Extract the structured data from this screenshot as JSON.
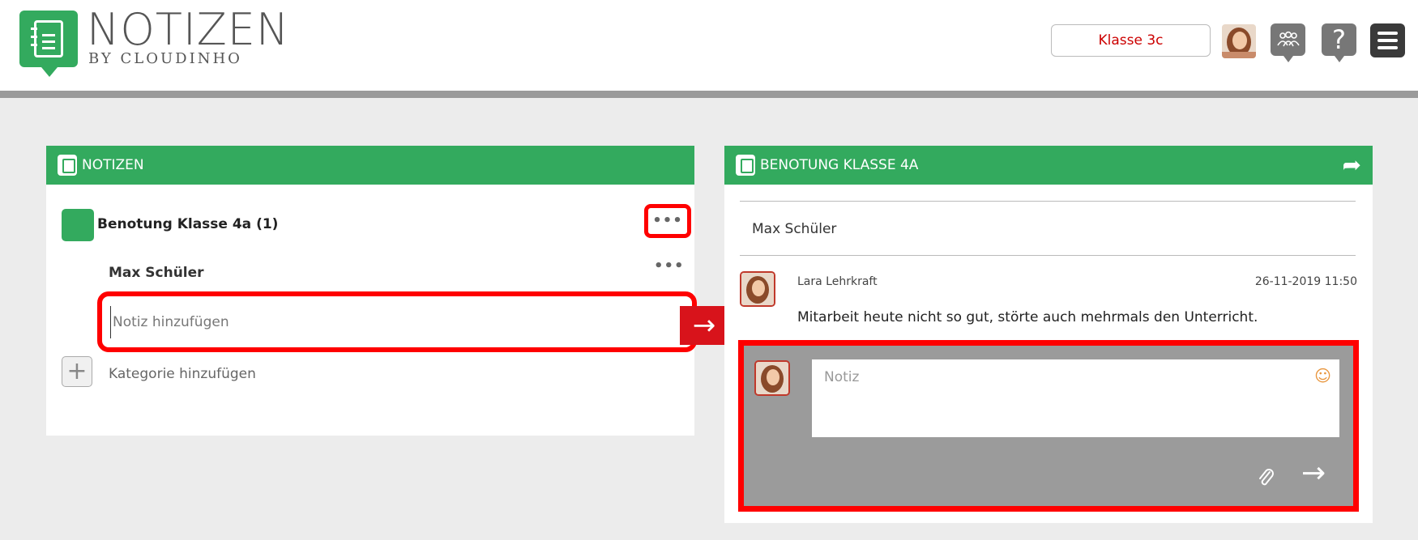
{
  "app": {
    "logo_title": "NOTIZEN",
    "logo_subtitle": "BY CLOUDINHO"
  },
  "header": {
    "class_selector": "Klasse 3c",
    "icons": [
      "avatar",
      "group-icon",
      "help-icon",
      "menu-icon"
    ],
    "help_glyph": "?"
  },
  "left_panel": {
    "title": "NOTIZEN",
    "category": {
      "title": "Benotung Klasse 4a (1)",
      "more": "•••",
      "color": "#33aa5e"
    },
    "student": {
      "name": "Max Schüler",
      "more": "•••"
    },
    "note_input": {
      "placeholder": "Notiz hinzufügen",
      "value": ""
    },
    "send_glyph": "→",
    "add_glyph": "+",
    "add_category_label": "Kategorie hinzufügen"
  },
  "right_panel": {
    "title": "BENOTUNG KLASSE 4A",
    "share_glyph": "➦",
    "student_name": "Max Schüler",
    "message": {
      "author": "Lara Lehrkraft",
      "timestamp": "26-11-2019 11:50",
      "text": "Mitarbeit heute nicht so gut, störte auch mehrmals den Unterricht."
    },
    "compose": {
      "placeholder": "Notiz",
      "value": "",
      "emoji_glyph": "☺",
      "attach_glyph": "📎",
      "send_glyph": "→"
    }
  },
  "colors": {
    "brand_green": "#33aa5e",
    "highlight_red": "#ff0000",
    "send_red": "#d8131b",
    "class_text_red": "#cc0000",
    "background": "#ececec"
  }
}
